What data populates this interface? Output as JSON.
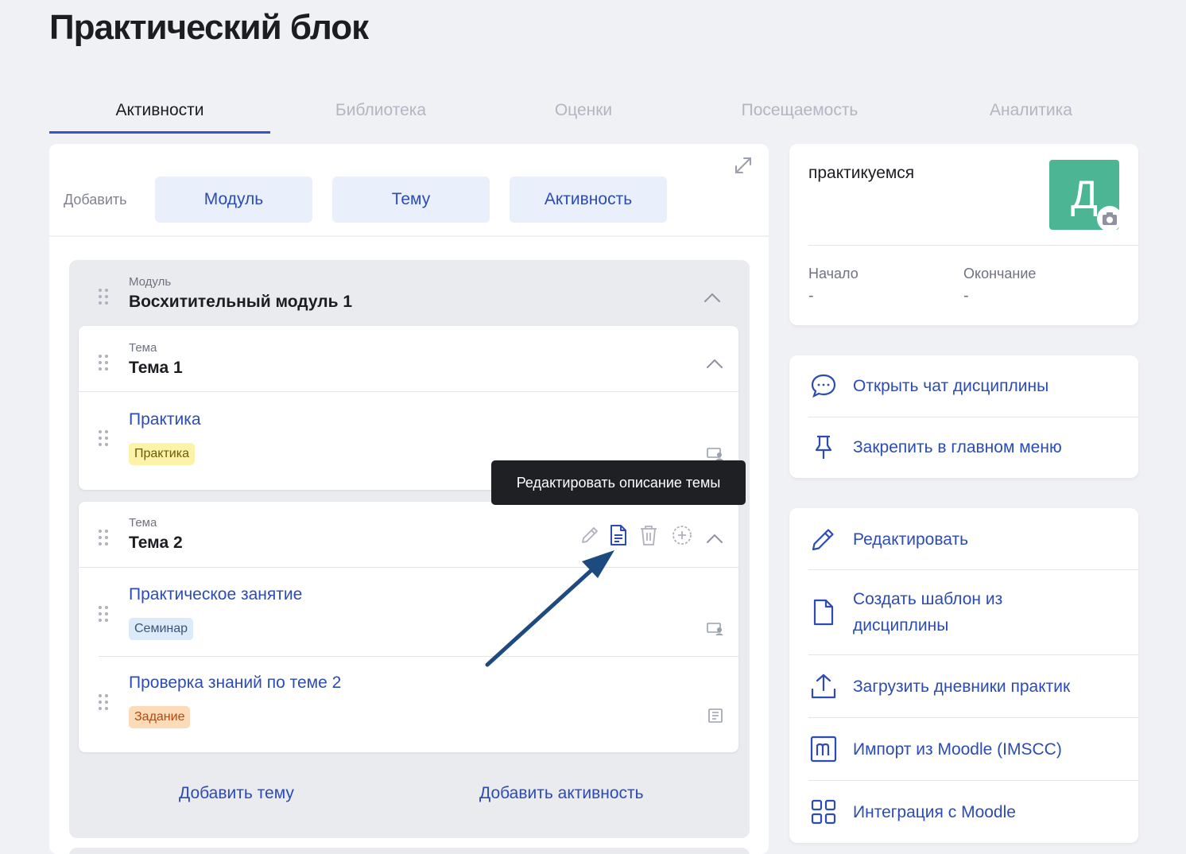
{
  "page": {
    "title": "Практический блок"
  },
  "tabs": [
    {
      "label": "Активности"
    },
    {
      "label": "Библиотека"
    },
    {
      "label": "Оценки"
    },
    {
      "label": "Посещаемость"
    },
    {
      "label": "Аналитика"
    }
  ],
  "add_bar": {
    "label": "Добавить",
    "buttons": [
      {
        "label": "Модуль"
      },
      {
        "label": "Тему"
      },
      {
        "label": "Активность"
      }
    ]
  },
  "module": {
    "type_label": "Модуль",
    "name": "Восхитительный модуль 1",
    "topics": [
      {
        "type_label": "Тема",
        "name": "Тема 1",
        "activities": [
          {
            "title": "Практика",
            "badge": "Практика",
            "badge_color": "#fcf3a8",
            "badge_text_color": "#6e5a0c",
            "icon": "webinar-icon"
          }
        ]
      },
      {
        "type_label": "Тема",
        "name": "Тема 2",
        "activities": [
          {
            "title": "Практическое занятие",
            "badge": "Семинар",
            "badge_color": "#dcebfa",
            "badge_text_color": "#3e5577",
            "icon": "webinar-icon"
          },
          {
            "title": "Проверка знаний по теме 2",
            "badge": "Задание",
            "badge_color": "#fcdbb8",
            "badge_text_color": "#b4490e",
            "icon": "assignment-icon"
          }
        ]
      }
    ],
    "add_topic": "Добавить тему",
    "add_activity": "Добавить активность"
  },
  "tooltip": {
    "text": "Редактировать описание темы"
  },
  "course": {
    "name": "практикуемся",
    "avatar_letter": "Д",
    "avatar_color": "#4bb594",
    "start_label": "Начало",
    "start_value": "-",
    "end_label": "Окончание",
    "end_value": "-"
  },
  "quick_actions": [
    {
      "label": "Открыть чат дисциплины",
      "icon": "chat-icon"
    },
    {
      "label": "Закрепить в главном меню",
      "icon": "pin-icon"
    }
  ],
  "actions": [
    {
      "label": "Редактировать",
      "icon": "pencil-icon"
    },
    {
      "label": "Создать шаблон из дисциплины",
      "icon": "document-icon"
    },
    {
      "label": "Загрузить дневники практик",
      "icon": "upload-icon"
    },
    {
      "label": "Импорт из Moodle (IMSCC)",
      "icon": "moodle-icon"
    },
    {
      "label": "Интеграция с Moodle",
      "icon": "grid-icon"
    }
  ],
  "colors": {
    "accent": "#2c4bb5",
    "tab_underline": "#3554c8",
    "arrow": "#1d4a7f"
  }
}
